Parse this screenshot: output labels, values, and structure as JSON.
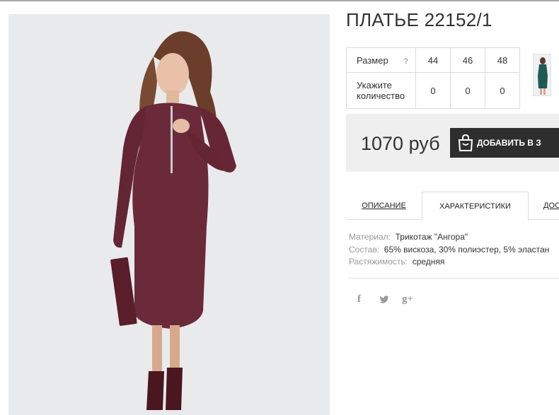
{
  "product": {
    "title": "ПЛАТЬЕ 22152/1"
  },
  "size_table": {
    "size_label": "Размер",
    "help_symbol": "?",
    "sizes": [
      "44",
      "46",
      "48"
    ],
    "quantity_label_line1": "Укажите",
    "quantity_label_line2": "количество",
    "quantities": [
      "0",
      "0",
      "0"
    ]
  },
  "purchase": {
    "price": "1070 руб",
    "add_button_label": "ДОБАВИТЬ В З"
  },
  "tabs": [
    {
      "label": "ОПИСАНИЕ",
      "active": false
    },
    {
      "label": "ХАРАКТЕРИСТИКИ",
      "active": true
    },
    {
      "label": "ДОС",
      "active": false
    }
  ],
  "characteristics": [
    {
      "key": "Материал:",
      "value": "Трикотаж \"Ангора\""
    },
    {
      "key": "Состав:",
      "value": "65% вискоза, 30% полиэстер, 5% эластан"
    },
    {
      "key": "Растяжимость:",
      "value": "средняя"
    }
  ],
  "social": {
    "facebook": "f",
    "twitter": "🐦",
    "googleplus": "g+"
  },
  "colors": {
    "dress": "#6b2a3a",
    "photo_bg": "#e9eaec",
    "button_bg": "#2e2e2e",
    "thumb_dress": "#1f5a52"
  },
  "icons": [
    "bag-icon",
    "help-icon",
    "facebook-icon",
    "twitter-icon",
    "google-plus-icon"
  ]
}
